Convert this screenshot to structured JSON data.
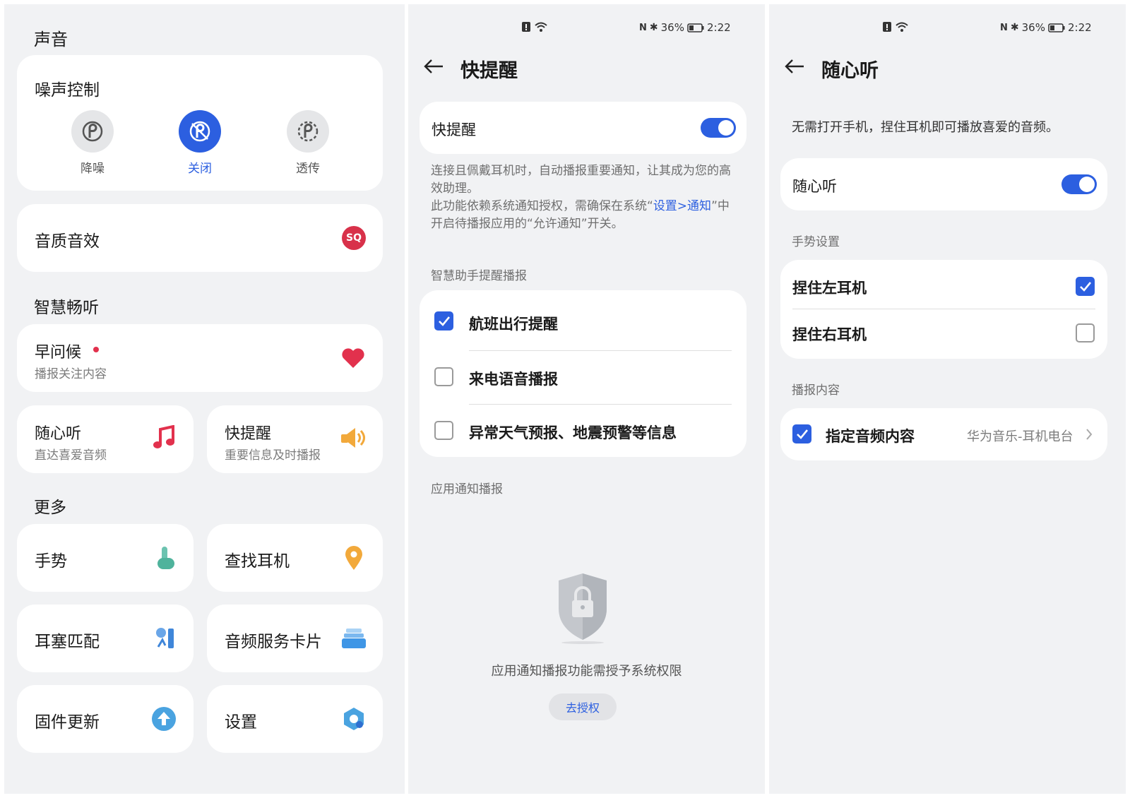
{
  "panel1": {
    "sound_title": "声音",
    "noise_card": {
      "title": "噪声控制",
      "modes": [
        {
          "label": "降噪",
          "icon": "noise-cancel-icon",
          "active": false
        },
        {
          "label": "关闭",
          "icon": "noise-off-icon",
          "active": true
        },
        {
          "label": "透传",
          "icon": "transparency-icon",
          "active": false
        }
      ]
    },
    "quality_card": {
      "label": "音质音效",
      "badge": "SQ"
    },
    "smart_title": "智慧畅听",
    "morning": {
      "title": "早问候",
      "subtitle": "播报关注内容"
    },
    "free_listen": {
      "title": "随心听",
      "subtitle": "直达喜爱音频"
    },
    "quick_remind": {
      "title": "快提醒",
      "subtitle": "重要信息及时播报"
    },
    "more_title": "更多",
    "more_items": [
      {
        "label": "手势",
        "icon": "gesture-icon"
      },
      {
        "label": "查找耳机",
        "icon": "location-pin-icon"
      },
      {
        "label": "耳塞匹配",
        "icon": "ear-tip-fit-icon"
      },
      {
        "label": "音频服务卡片",
        "icon": "service-card-icon"
      },
      {
        "label": "固件更新",
        "icon": "firmware-update-icon"
      },
      {
        "label": "设置",
        "icon": "settings-hex-icon"
      }
    ],
    "colors": {
      "accent": "#2c5fe0",
      "sq_badge": "#d8314a",
      "heart": "#e2314d"
    }
  },
  "status_bar": {
    "battery": "36%",
    "time": "2:22"
  },
  "panel2": {
    "title": "快提醒",
    "toggle_label": "快提醒",
    "toggle_on": true,
    "desc_line1": "连接且佩戴耳机时，自动播报重要通知，让其成为您的高效助理。",
    "desc_line2_before": "此功能依赖系统通知授权，需确保在系统“",
    "desc_link": "设置>通知",
    "desc_line2_after": "”中开启待播报应用的“允许通知”开关。",
    "assistant_header": "智慧助手提醒播报",
    "options": [
      {
        "label": "航班出行提醒",
        "checked": true
      },
      {
        "label": "来电语音播报",
        "checked": false
      },
      {
        "label": "异常天气预报、地震预警等信息",
        "checked": false
      }
    ],
    "app_notify_header": "应用通知播报",
    "empty_text": "应用通知播报功能需授予系统权限",
    "authorize_button": "去授权"
  },
  "panel3": {
    "title": "随心听",
    "intro": "无需打开手机，捏住耳机即可播放喜爱的音频。",
    "toggle_label": "随心听",
    "toggle_on": true,
    "gesture_header": "手势设置",
    "gestures": [
      {
        "label": "捏住左耳机",
        "checked": true
      },
      {
        "label": "捏住右耳机",
        "checked": false
      }
    ],
    "content_header": "播报内容",
    "content_item": {
      "label": "指定音频内容",
      "value": "华为音乐-耳机电台",
      "checked": true
    }
  }
}
